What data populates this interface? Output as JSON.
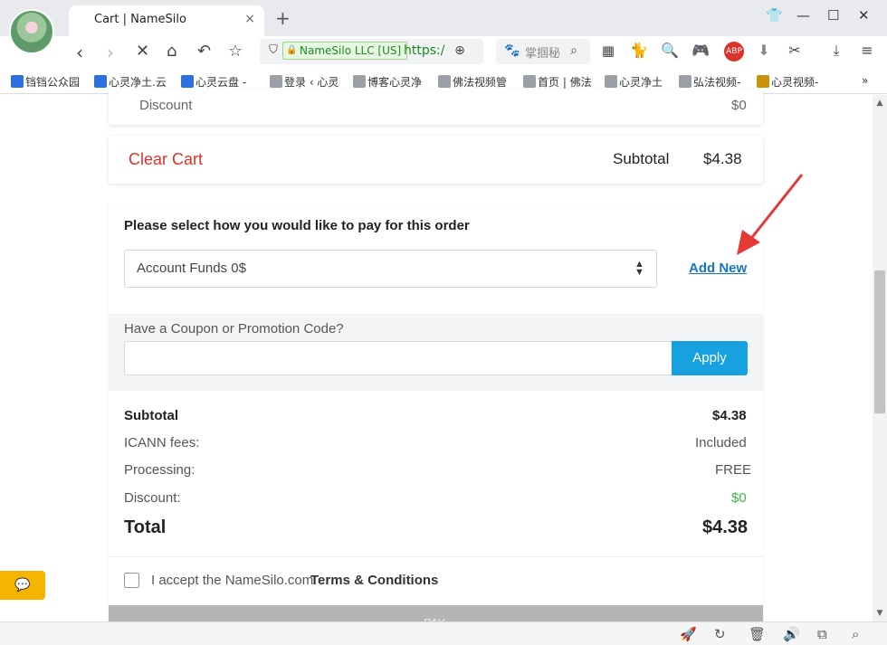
{
  "browser": {
    "tab_title": "Cart | NameSilo",
    "tab_close": "×",
    "new_tab": "+",
    "secure_label": "NameSilo LLC [US]",
    "url_text": "https:/",
    "search_placeholder": "掌掴秘",
    "window_controls": {
      "minimize": "—",
      "maximize": "☐",
      "close": "✕"
    }
  },
  "bookmarks": [
    {
      "label": "铛铛公众园",
      "color": "#2b6fe0"
    },
    {
      "label": "心灵净土.云",
      "color": "#2b6fe0"
    },
    {
      "label": "心灵云盘 -",
      "color": "#2b6fe0"
    },
    {
      "label": "登录 ‹ 心灵",
      "color": "#9aa0a6"
    },
    {
      "label": "博客心灵净",
      "color": "#9aa0a6"
    },
    {
      "label": "佛法视频管",
      "color": "#9aa0a6"
    },
    {
      "label": "首页 | 佛法",
      "color": "#9aa0a6"
    },
    {
      "label": "心灵净土",
      "color": "#9aa0a6"
    },
    {
      "label": "弘法视频-",
      "color": "#9aa0a6"
    },
    {
      "label": "心灵视频-",
      "color": "#c8920a"
    }
  ],
  "bookmarks_more": "»",
  "cart": {
    "discount_label": "Discount",
    "discount_value": "$0",
    "clear_cart": "Clear Cart",
    "subtotal_label": "Subtotal",
    "subtotal_value": "$4.38"
  },
  "payment": {
    "heading": "Please select how you would like to pay for this order",
    "method_selected": "Account Funds 0$",
    "add_new": "Add New"
  },
  "coupon": {
    "label": "Have a Coupon or Promotion Code?",
    "input_value": "",
    "apply": "Apply"
  },
  "summary": {
    "subtotal_label": "Subtotal",
    "subtotal_value": "$4.38",
    "icann_label": "ICANN fees:",
    "icann_value": "Included",
    "processing_label": "Processing:",
    "processing_value": "FREE",
    "discount_label": "Discount:",
    "discount_value": "$0",
    "total_label": "Total",
    "total_value": "$4.38"
  },
  "terms": {
    "prefix": "I accept the NameSilo.com ",
    "link": "Terms & Conditions"
  },
  "pay_button": "PAY",
  "colors": {
    "clear_cart": "#d9342b",
    "link": "#1577c2",
    "apply": "#17a2df",
    "discount_green": "#3cb64a",
    "arrow": "#e53935",
    "chat": "#f5b400"
  }
}
